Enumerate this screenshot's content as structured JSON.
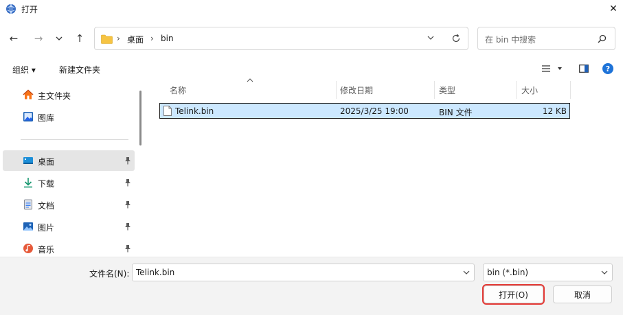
{
  "window": {
    "title": "打开",
    "icon": "globe-app-icon",
    "close_glyph": "✕"
  },
  "nav": {
    "back_glyph": "←",
    "forward_glyph": "→",
    "recent_glyph": "⌄",
    "up_glyph": "↑",
    "breadcrumbs": [
      "桌面",
      "bin"
    ],
    "separator": "›",
    "search_placeholder": "在 bin 中搜索"
  },
  "toolbar": {
    "organize": "组织 ▾",
    "new_folder": "新建文件夹",
    "help_glyph": "?"
  },
  "sidebar": {
    "items": [
      {
        "label": "主文件夹",
        "icon": "home-icon"
      },
      {
        "label": "图库",
        "icon": "gallery-icon"
      },
      {
        "label": "桌面",
        "icon": "desktop-icon",
        "selected": true
      },
      {
        "label": "下载",
        "icon": "download-icon"
      },
      {
        "label": "文档",
        "icon": "document-icon"
      },
      {
        "label": "图片",
        "icon": "picture-icon"
      },
      {
        "label": "音乐",
        "icon": "music-icon"
      }
    ]
  },
  "filelist": {
    "columns": [
      "名称",
      "修改日期",
      "类型",
      "大小"
    ],
    "rows": [
      {
        "name": "Telink.bin",
        "modified": "2025/3/25 19:00",
        "type": "BIN 文件",
        "size": "12 KB"
      }
    ]
  },
  "footer": {
    "filename_label": "文件名(N):",
    "filename_value": "Telink.bin",
    "filetype_value": "bin (*.bin)",
    "open_button": "打开(O)",
    "cancel_button": "取消",
    "highlight_color": "#e53935"
  }
}
